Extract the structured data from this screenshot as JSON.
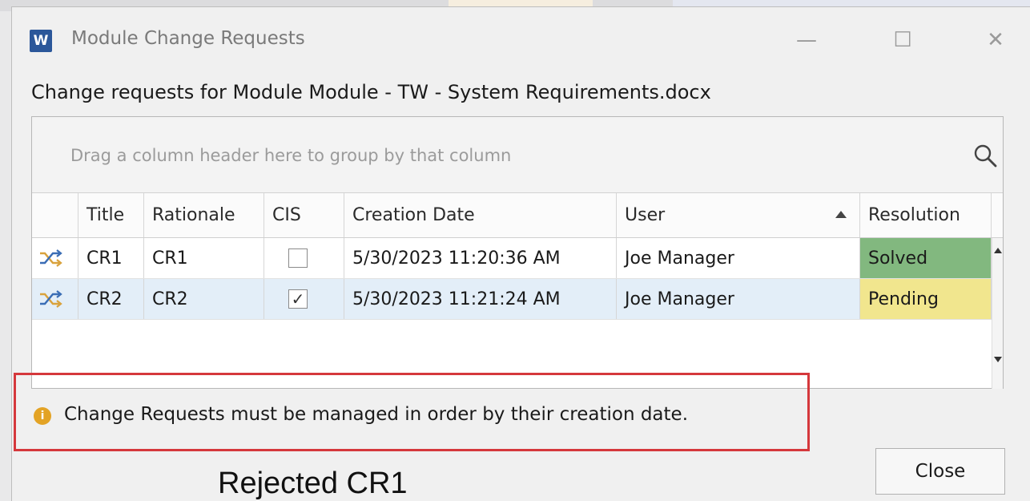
{
  "window": {
    "title": "Module Change Requests",
    "app_icon_label": "W",
    "minimize_glyph": "—",
    "maximize_glyph": "☐",
    "close_glyph": "✕"
  },
  "heading": "Change requests for Module Module - TW - System Requirements.docx",
  "grid": {
    "group_hint": "Drag a column header here to group by that column",
    "columns": [
      "Title",
      "Rationale",
      "CIS",
      "Creation Date",
      "User",
      "Resolution"
    ],
    "sorted_column": "User",
    "sort_direction": "ascending",
    "rows": [
      {
        "title": "CR1",
        "rationale": "CR1",
        "cis": false,
        "cis_mark": "",
        "creation_date": "5/30/2023 11:20:36 AM",
        "user": "Joe Manager",
        "resolution": "Solved"
      },
      {
        "title": "CR2",
        "rationale": "CR2",
        "cis": true,
        "cis_mark": "✓",
        "creation_date": "5/30/2023 11:21:24 AM",
        "user": "Joe Manager",
        "resolution": "Pending"
      }
    ],
    "resolution_colors": {
      "Solved": "#82b87f",
      "Pending": "#f1e68e"
    },
    "selected_row_color": "#e3eef8"
  },
  "message": {
    "icon": "info-icon",
    "icon_glyph": "i",
    "text": "Change Requests must be managed in order by their creation date."
  },
  "close_button_label": "Close",
  "caption": "Rejected CR1",
  "colors": {
    "highlight_border": "#d5383c",
    "word_blue": "#2b579a",
    "info_orange": "#e3a325"
  }
}
